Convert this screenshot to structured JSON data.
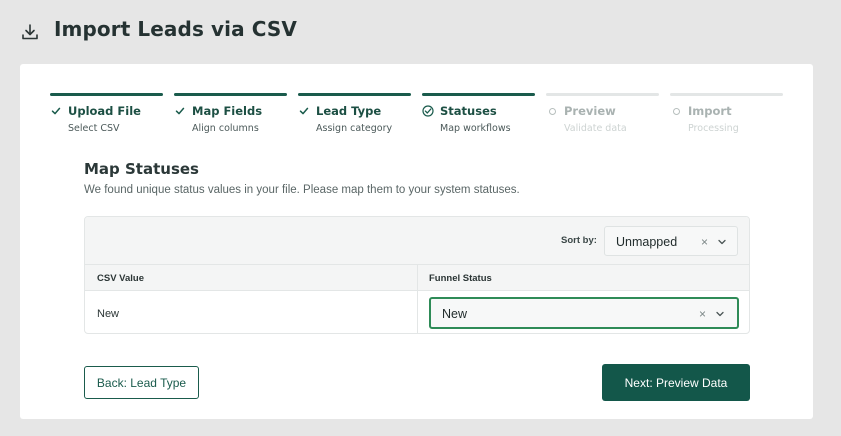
{
  "header": {
    "title": "Import Leads via CSV",
    "icon": "download-icon"
  },
  "steps": [
    {
      "title": "Upload File",
      "subtitle": "Select CSV",
      "status": "complete"
    },
    {
      "title": "Map Fields",
      "subtitle": "Align columns",
      "status": "complete"
    },
    {
      "title": "Lead Type",
      "subtitle": "Assign category",
      "status": "complete"
    },
    {
      "title": "Statuses",
      "subtitle": "Map workflows",
      "status": "current"
    },
    {
      "title": "Preview",
      "subtitle": "Validate data",
      "status": "pending"
    },
    {
      "title": "Import",
      "subtitle": "Processing",
      "status": "pending"
    }
  ],
  "section": {
    "title": "Map Statuses",
    "description": "We found unique status values in your file. Please map them to your system statuses."
  },
  "toolbar": {
    "sort_label": "Sort by:",
    "sort_value": "Unmapped"
  },
  "table": {
    "columns": [
      "CSV Value",
      "Funnel Status"
    ],
    "rows": [
      {
        "csv_value": "New",
        "funnel_status": "New"
      }
    ]
  },
  "buttons": {
    "back_label": "Back: Lead Type",
    "next_label": "Next: Preview Data"
  },
  "colors": {
    "primary": "#13574a",
    "accent_border": "#2e8b57",
    "background": "#e6e6e6"
  }
}
